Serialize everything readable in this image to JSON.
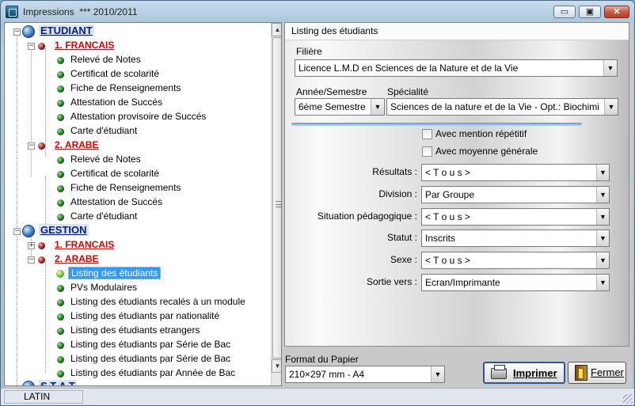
{
  "window": {
    "title": "Impressions",
    "year_label": "*** 2010/2011",
    "minimize_symbol": "▭",
    "maximize_symbol": "▣",
    "close_symbol": "✕"
  },
  "tree": {
    "etudiant": {
      "label": "ETUDIANT",
      "francais": {
        "label": "1. FRANCAIS",
        "items": [
          "Relevé de Notes",
          "Certificat de scolarité",
          "Fiche de Renseignements",
          "Attestation de Succés",
          "Attestation provisoire de Succés",
          "Carte d'étudiant"
        ]
      },
      "arabe": {
        "label": "2. ARABE",
        "items": [
          "Relevé de Notes",
          "Certificat de scolarité",
          "Fiche de Renseignements",
          "Attestation de Succés",
          "Carte d'étudiant"
        ]
      }
    },
    "gestion": {
      "label": "GESTION",
      "francais": {
        "label": "1. FRANCAIS"
      },
      "arabe": {
        "label": "2. ARABE",
        "items": [
          "Listing des étudiants",
          "PVs Modulaires",
          "Listing des étudiants recalés à un module",
          "Listing des étudiants par nationalité",
          "Listing des étudiants etrangers",
          "Listing des étudiants par Série de Bac",
          "Listing des étudiants par Série de Bac",
          "Listing des étudiants par Année de Bac"
        ]
      }
    },
    "stat": {
      "label": "S T A T"
    },
    "selected_item": "Listing des étudiants"
  },
  "form": {
    "header": "Listing des étudiants",
    "filiere_label": "Filière",
    "filiere_value": "Licence L.M.D en Sciences de la Nature et de la Vie",
    "annee_label": "Année/Semestre",
    "annee_value": "6ème Semestre",
    "specialite_label": "Spécialité",
    "specialite_value": "Sciences de la nature et de la Vie - Opt.: Biochimi",
    "chk_mention_label": "Avec mention répétitif",
    "chk_moyenne_label": "Avec moyenne générale",
    "fields": [
      {
        "label": "Résultats :",
        "value": "< T o u s >"
      },
      {
        "label": "Division :",
        "value": "Par Groupe"
      },
      {
        "label": "Situation pédagogique :",
        "value": "< T o u s >"
      },
      {
        "label": "Statut :",
        "value": "Inscrits"
      },
      {
        "label": "Sexe :",
        "value": "< T o u s >"
      },
      {
        "label": "Sortie vers :",
        "value": "Ecran/Imprimante"
      }
    ]
  },
  "footer": {
    "format_label": "Format du Papier",
    "format_value": "210×297 mm - A4",
    "print_button": "Imprimer",
    "close_button": "Fermer"
  },
  "statusbar": {
    "keyboard": "LATIN"
  },
  "icons": {
    "combo_arrow": "▼",
    "scroll_up": "▲",
    "scroll_down": "▼",
    "expand": "+",
    "collapse": "−"
  }
}
